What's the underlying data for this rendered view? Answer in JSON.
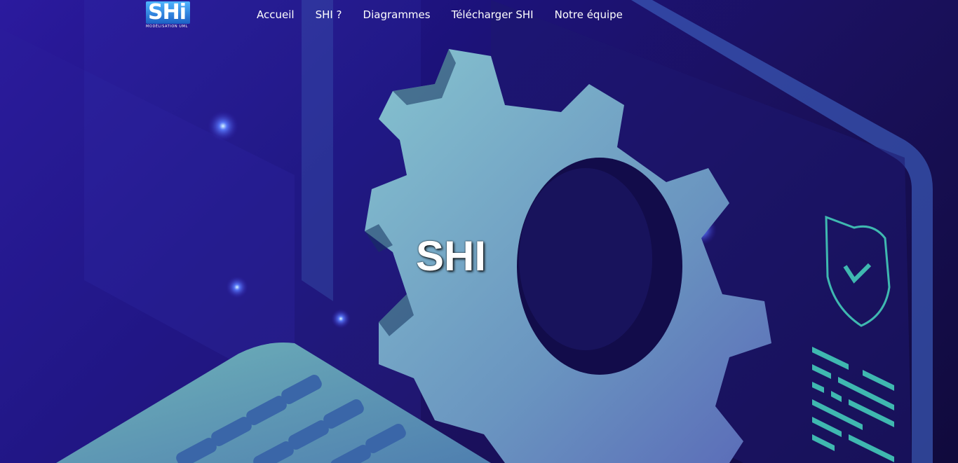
{
  "header": {
    "logo": {
      "text": "SHi",
      "subtitle": "MODÉLISATION UML"
    },
    "nav": [
      {
        "label": "Accueil"
      },
      {
        "label": "SHI ?"
      },
      {
        "label": "Diagrammes"
      },
      {
        "label": "Télécharger SHI"
      },
      {
        "label": "Notre équipe"
      }
    ]
  },
  "hero": {
    "title": "SHI",
    "background_icons": [
      "gear-icon",
      "laptop-keyboard-icon",
      "shield-check-icon",
      "code-lines-icon"
    ]
  },
  "colors": {
    "background_primary": "#2b1a9e",
    "background_dark": "#100a3c",
    "accent_teal": "#3fb8b0",
    "gear": "#7ab0c8"
  }
}
